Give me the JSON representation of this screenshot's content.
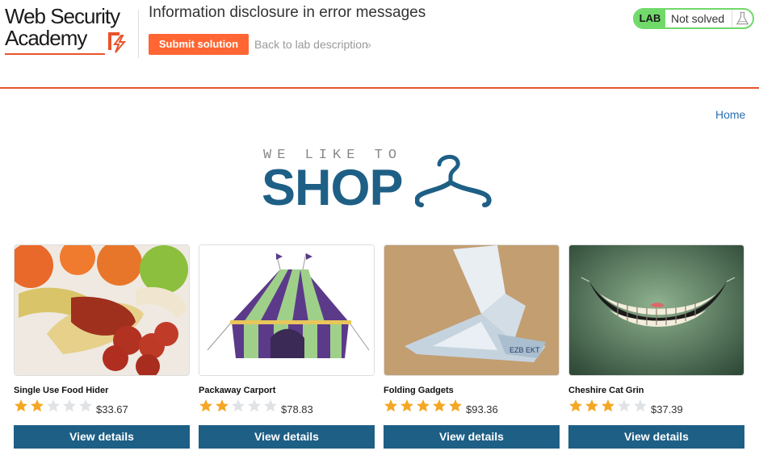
{
  "header": {
    "logo_line1": "Web Security",
    "logo_line2": "Academy",
    "lab_title": "Information disclosure in error messages",
    "submit_label": "Submit solution",
    "back_label": "Back to lab description",
    "back_chevron": "»",
    "status_badge": "LAB",
    "status_text": "Not solved"
  },
  "nav": {
    "home_label": "Home"
  },
  "banner": {
    "tagline": "WE LIKE TO",
    "word": "SHOP"
  },
  "colors": {
    "accent_orange": "#ff6633",
    "brand_blue": "#1e5f85",
    "status_green": "#70d96a",
    "star_gold": "#f5a623",
    "star_empty": "#dfe3e6"
  },
  "products": [
    {
      "name": "Single Use Food Hider",
      "rating": 2,
      "price": "$33.67",
      "button": "View details"
    },
    {
      "name": "Packaway Carport",
      "rating": 2,
      "price": "$78.83",
      "button": "View details"
    },
    {
      "name": "Folding Gadgets",
      "rating": 5,
      "price": "$93.36",
      "button": "View details"
    },
    {
      "name": "Cheshire Cat Grin",
      "rating": 3,
      "price": "$37.39",
      "button": "View details"
    }
  ]
}
